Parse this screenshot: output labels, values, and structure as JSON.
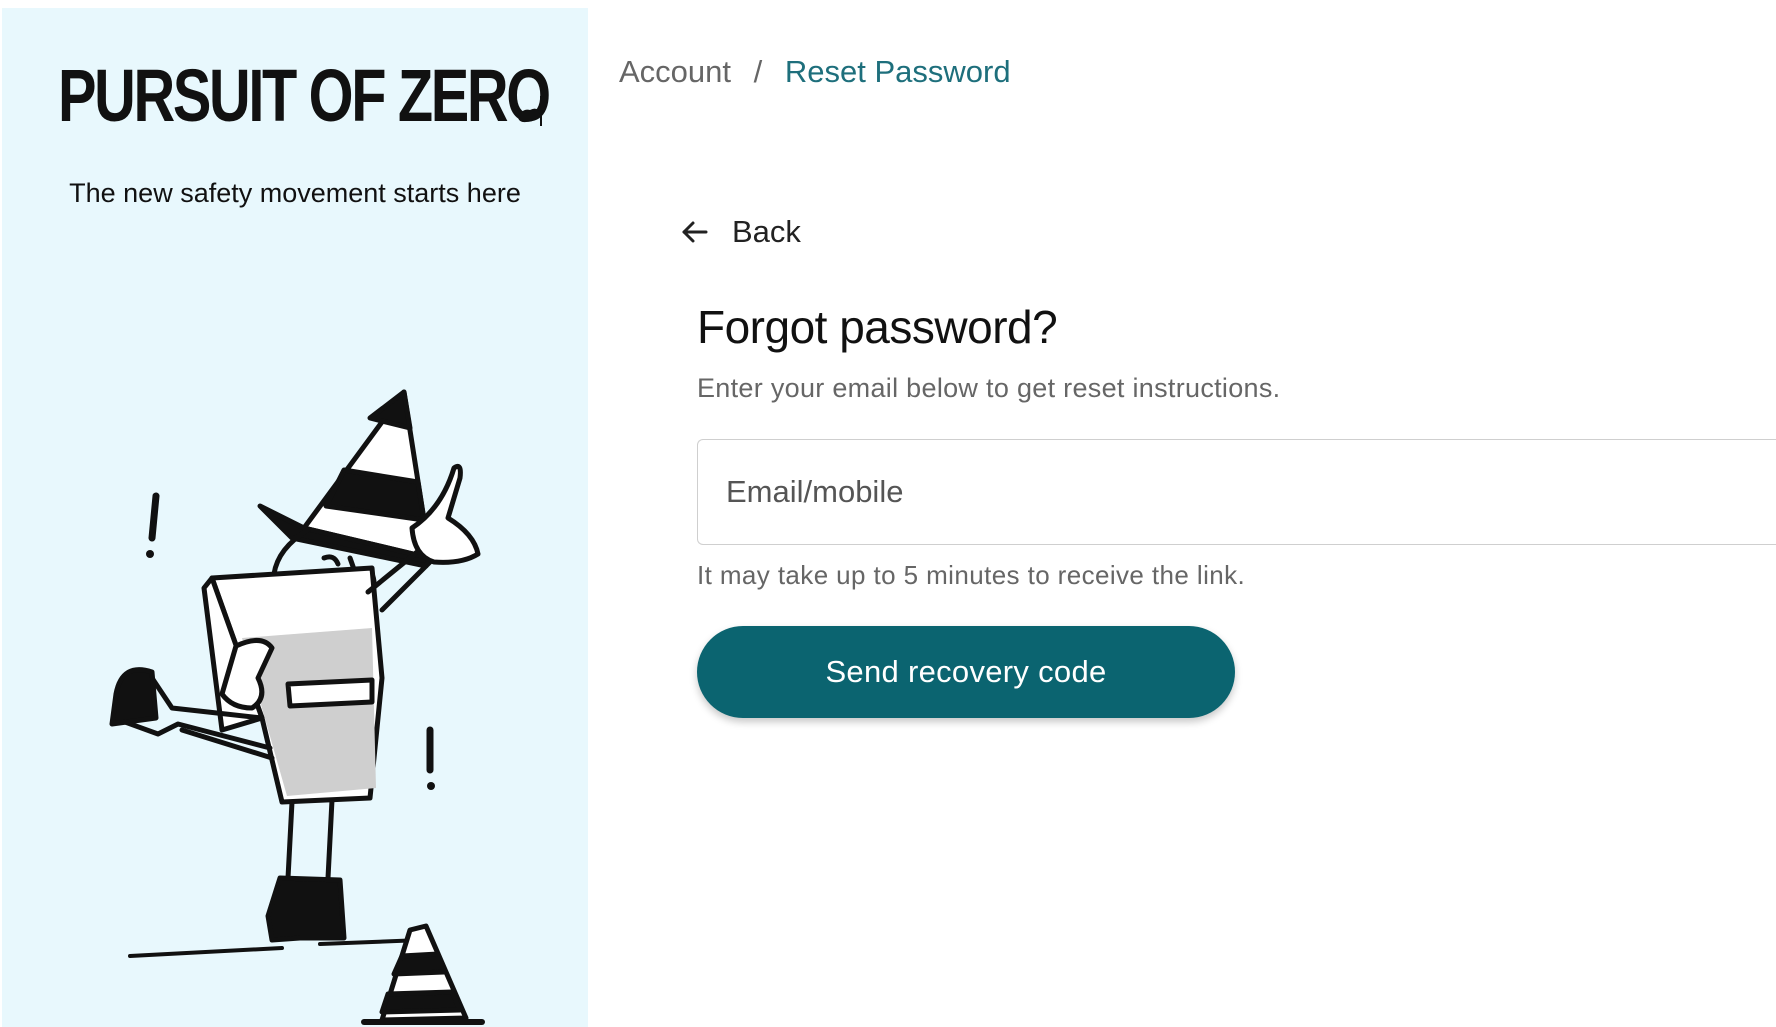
{
  "brand": {
    "logo_text": "PURSUIT OF ZERO",
    "tagline": "The new safety movement starts here"
  },
  "breadcrumb": {
    "parent": "Account",
    "separator": "/",
    "current": "Reset Password"
  },
  "back": {
    "label": "Back",
    "icon": "arrow-left-icon"
  },
  "form": {
    "title": "Forgot password?",
    "subtitle": "Enter your email below to get reset instructions.",
    "email_placeholder": "Email/mobile",
    "email_value": "",
    "hint": "It may take up to 5 minutes to receive the link.",
    "submit_label": "Send recovery code"
  },
  "colors": {
    "accent": "#0b6470",
    "breadcrumb_active": "#1e6f7c",
    "panel_background": "#e8f8fd"
  }
}
